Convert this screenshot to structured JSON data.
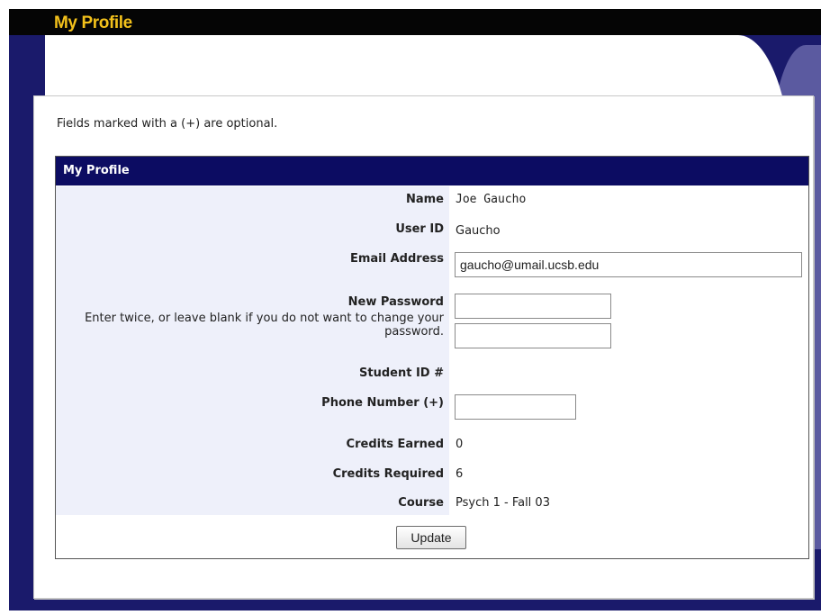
{
  "app": {
    "title": "My Profile"
  },
  "note": "Fields marked with a (+) are optional.",
  "form": {
    "header": "My Profile",
    "name_label": "Name",
    "name_value": "Joe Gaucho",
    "userid_label": "User ID",
    "userid_value": "Gaucho",
    "email_label": "Email Address",
    "email_value": "gaucho@umail.ucsb.edu",
    "password_label": "New Password",
    "password_hint": "Enter twice, or leave blank if you do not want to change your password.",
    "password_value": "",
    "password_confirm_value": "",
    "studentid_label": "Student ID #",
    "phone_label": "Phone Number (+)",
    "phone_value": "",
    "credits_earned_label": "Credits Earned",
    "credits_earned_value": "0",
    "credits_required_label": "Credits Required",
    "credits_required_value": "6",
    "course_label": "Course",
    "course_value": "Psych 1 - Fall 03",
    "update_label": "Update"
  },
  "colors": {
    "title_bar": "#050505",
    "title_text": "#f3c11b",
    "frame": "#1a1a6b",
    "header_bar": "#0c0c62",
    "label_column": "#eef0fa"
  }
}
